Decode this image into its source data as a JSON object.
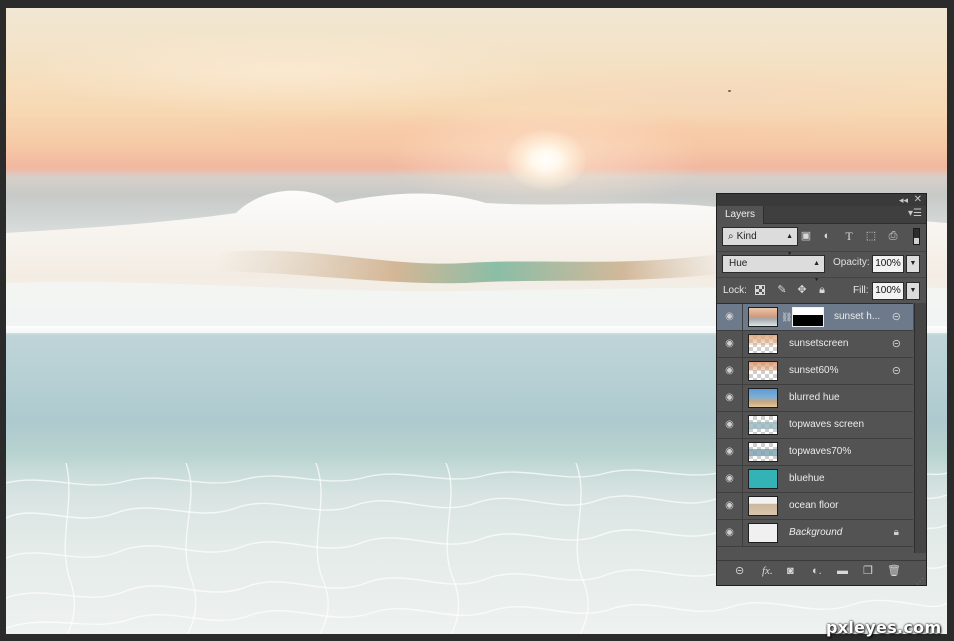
{
  "panel": {
    "tab": "Layers",
    "filter": {
      "kind_label": "Kind"
    },
    "blend_mode": "Hue",
    "opacity_label": "Opacity:",
    "opacity_value": "100%",
    "lock_label": "Lock:",
    "fill_label": "Fill:",
    "fill_value": "100%",
    "layers": [
      {
        "name": "sunset h...",
        "selected": true,
        "linked": true
      },
      {
        "name": "sunsetscreen",
        "linked": true
      },
      {
        "name": "sunset60%",
        "linked": true
      },
      {
        "name": "blurred hue"
      },
      {
        "name": "topwaves screen"
      },
      {
        "name": "topwaves70%"
      },
      {
        "name": "bluehue"
      },
      {
        "name": "ocean floor"
      },
      {
        "name": "Background",
        "locked": true
      }
    ]
  },
  "watermark": "pxleyes.com",
  "icons": {
    "eye": "eye-icon",
    "link": "link-icon",
    "lock": "lock-icon",
    "fx": "fx-icon",
    "mask": "add-mask-icon",
    "adjustment": "adjustment-layer-icon",
    "folder": "folder-icon",
    "new_layer": "new-layer-icon",
    "trash": "trash-icon"
  },
  "colors": {
    "panel_bg": "#535353",
    "selected_row": "#6c7a8b",
    "bluehue_thumb": "#34b3b7"
  }
}
